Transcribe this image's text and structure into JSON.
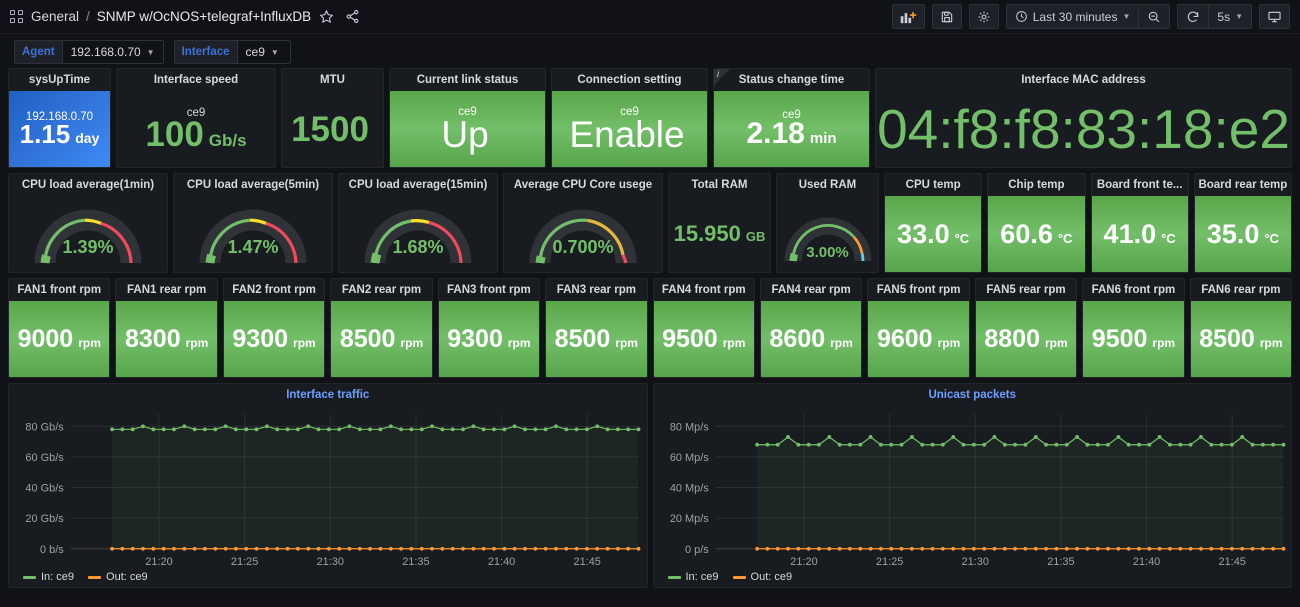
{
  "nav": {
    "grid_icon": "dashboards-grid-icon",
    "folder": "General",
    "separator": "/",
    "dashboard_title": "SNMP w/OcNOS+telegraf+InfluxDB",
    "star_icon": "star-icon",
    "share_icon": "share-icon",
    "toolbar": {
      "add_panel_label": "add-panel-icon",
      "save_label": "save-dashboard-icon",
      "settings_label": "dashboard-settings-icon",
      "time_range": "Last 30 minutes",
      "zoom_out_label": "zoom-out-time-icon",
      "refresh_label": "refresh-icon",
      "refresh_interval": "5s",
      "kiosk_label": "tv-mode-icon"
    }
  },
  "variables": [
    {
      "label": "Agent",
      "value": "192.168.0.70"
    },
    {
      "label": "Interface",
      "value": "ce9"
    }
  ],
  "colors": {
    "green": "#73bf69",
    "blue": "#3274d9",
    "orange": "#ff9830",
    "red": "#f2495c",
    "yellow": "#fade2a",
    "lightblue": "#5794f2",
    "panel_bg": "#181b1f",
    "page_bg": "#111217"
  },
  "row1": [
    {
      "title": "sysUpTime",
      "series": "192.168.0.70",
      "value": "1.15",
      "unit": "day",
      "style": "blue-bg"
    },
    {
      "title": "Interface speed",
      "series": "ce9",
      "value": "100",
      "unit": "Gb/s",
      "style": "dark-green-text"
    },
    {
      "title": "MTU",
      "series": "",
      "value": "1500",
      "unit": "",
      "style": "dark-green-text"
    },
    {
      "title": "Current link status",
      "series": "ce9",
      "value": "Up",
      "unit": "",
      "style": "green-bg"
    },
    {
      "title": "Connection setting",
      "series": "ce9",
      "value": "Enable",
      "unit": "",
      "style": "green-bg"
    },
    {
      "title": "Status change time",
      "series": "ce9",
      "value": "2.18",
      "unit": "min",
      "style": "green-bg",
      "has_info": true
    },
    {
      "title": "Interface MAC address",
      "series": "",
      "value": "04:f8:f8:83:18:e2",
      "unit": "",
      "style": "dark-green-text"
    }
  ],
  "row2_gauges": [
    {
      "title": "CPU load average(1min)",
      "value": "1.39%",
      "pct": 1.39,
      "scheme": "grt"
    },
    {
      "title": "CPU load average(5min)",
      "value": "1.47%",
      "pct": 1.47,
      "scheme": "grt"
    },
    {
      "title": "CPU load average(15min)",
      "value": "1.68%",
      "pct": 1.68,
      "scheme": "grt"
    },
    {
      "title": "Average CPU Core usege",
      "value": "0.700%",
      "pct": 0.7,
      "scheme": "gyr"
    }
  ],
  "row2_stats": [
    {
      "title": "Total RAM",
      "value": "15.950",
      "unit": "GB"
    }
  ],
  "row2_usedram": {
    "title": "Used RAM",
    "value": "3.00%",
    "pct": 3.0
  },
  "row2_temps": [
    {
      "title": "CPU temp",
      "value": "33.0",
      "unit": "°C"
    },
    {
      "title": "Chip temp",
      "value": "60.6",
      "unit": "°C"
    },
    {
      "title": "Board front te...",
      "value": "41.0",
      "unit": "°C"
    },
    {
      "title": "Board rear temp",
      "value": "35.0",
      "unit": "°C"
    }
  ],
  "row3_fans": [
    {
      "title": "FAN1 front rpm",
      "value": "9000",
      "unit": "rpm"
    },
    {
      "title": "FAN1 rear rpm",
      "value": "8300",
      "unit": "rpm"
    },
    {
      "title": "FAN2 front rpm",
      "value": "9300",
      "unit": "rpm"
    },
    {
      "title": "FAN2 rear rpm",
      "value": "8500",
      "unit": "rpm"
    },
    {
      "title": "FAN3 front rpm",
      "value": "9300",
      "unit": "rpm"
    },
    {
      "title": "FAN3 rear rpm",
      "value": "8500",
      "unit": "rpm"
    },
    {
      "title": "FAN4 front rpm",
      "value": "9500",
      "unit": "rpm"
    },
    {
      "title": "FAN4 rear rpm",
      "value": "8600",
      "unit": "rpm"
    },
    {
      "title": "FAN5 front rpm",
      "value": "9600",
      "unit": "rpm"
    },
    {
      "title": "FAN5 rear rpm",
      "value": "8800",
      "unit": "rpm"
    },
    {
      "title": "FAN6 front rpm",
      "value": "9500",
      "unit": "rpm"
    },
    {
      "title": "FAN6 rear rpm",
      "value": "8500",
      "unit": "rpm"
    }
  ],
  "chart_data": [
    {
      "type": "line",
      "title": "Interface traffic",
      "xlabel": "",
      "ylabel": "",
      "x_ticks": [
        "21:20",
        "21:25",
        "21:30",
        "21:35",
        "21:40",
        "21:45"
      ],
      "y_ticks": [
        "0 b/s",
        "20 Gb/s",
        "40 Gb/s",
        "60 Gb/s",
        "80 Gb/s"
      ],
      "ylim": [
        0,
        88
      ],
      "grid": true,
      "legend_position": "bottom-left",
      "series": [
        {
          "name": "In: ce9",
          "color": "#73bf69",
          "values": [
            78,
            78,
            78,
            80,
            78,
            78,
            78,
            80,
            78,
            78,
            78,
            80,
            78,
            78,
            78,
            80,
            78,
            78,
            78,
            80,
            78,
            78,
            78,
            80,
            78,
            78,
            78,
            80,
            78,
            78,
            78,
            80,
            78,
            78,
            78,
            80,
            78,
            78,
            78,
            80,
            78,
            78,
            78,
            80,
            78,
            78,
            78,
            80,
            78,
            78,
            78,
            80,
            78,
            78,
            78,
            78
          ]
        },
        {
          "name": "Out: ce9",
          "color": "#ff9830",
          "values": [
            0,
            0,
            0,
            0,
            0,
            0,
            0,
            0,
            0,
            0,
            0,
            0,
            0,
            0,
            0,
            0,
            0,
            0,
            0,
            0,
            0,
            0,
            0,
            0,
            0,
            0,
            0,
            0,
            0,
            0,
            0,
            0,
            0,
            0,
            0,
            0,
            0,
            0,
            0,
            0,
            0,
            0,
            0,
            0,
            0,
            0,
            0,
            0,
            0,
            0,
            0,
            0,
            0,
            0,
            0,
            0
          ]
        }
      ]
    },
    {
      "type": "line",
      "title": "Unicast packets",
      "xlabel": "",
      "ylabel": "",
      "x_ticks": [
        "21:20",
        "21:25",
        "21:30",
        "21:35",
        "21:40",
        "21:45"
      ],
      "y_ticks": [
        "0 p/s",
        "20 Mp/s",
        "40 Mp/s",
        "60 Mp/s",
        "80 Mp/s"
      ],
      "ylim": [
        0,
        88
      ],
      "grid": true,
      "legend_position": "bottom-left",
      "series": [
        {
          "name": "In: ce9",
          "color": "#73bf69",
          "values": [
            68,
            68,
            68,
            73,
            68,
            68,
            68,
            73,
            68,
            68,
            68,
            73,
            68,
            68,
            68,
            73,
            68,
            68,
            68,
            73,
            68,
            68,
            68,
            73,
            68,
            68,
            68,
            73,
            68,
            68,
            68,
            73,
            68,
            68,
            68,
            73,
            68,
            68,
            68,
            73,
            68,
            68,
            68,
            73,
            68,
            68,
            68,
            73,
            68,
            68,
            68,
            73,
            68,
            68,
            68,
            68
          ]
        },
        {
          "name": "Out: ce9",
          "color": "#ff9830",
          "values": [
            0,
            0,
            0,
            0,
            0,
            0,
            0,
            0,
            0,
            0,
            0,
            0,
            0,
            0,
            0,
            0,
            0,
            0,
            0,
            0,
            0,
            0,
            0,
            0,
            0,
            0,
            0,
            0,
            0,
            0,
            0,
            0,
            0,
            0,
            0,
            0,
            0,
            0,
            0,
            0,
            0,
            0,
            0,
            0,
            0,
            0,
            0,
            0,
            0,
            0,
            0,
            0,
            0,
            0,
            0,
            0
          ]
        }
      ]
    }
  ]
}
